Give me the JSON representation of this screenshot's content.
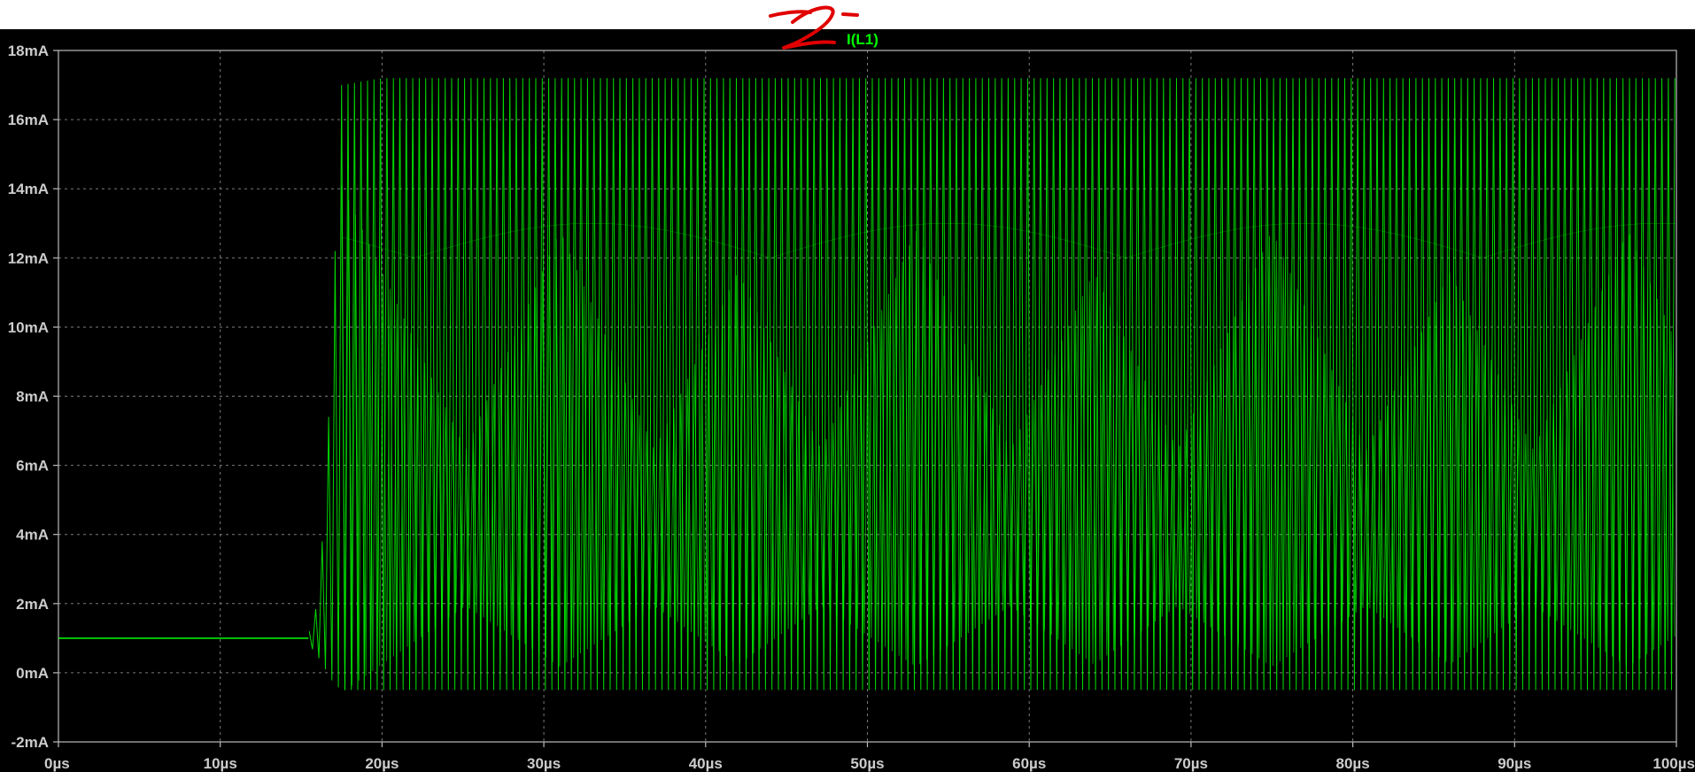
{
  "chart_data": {
    "type": "line",
    "title": "",
    "xlabel": "",
    "ylabel": "",
    "xlim": [
      0,
      100
    ],
    "ylim": [
      -2,
      18
    ],
    "x_unit": "µs",
    "y_unit": "mA",
    "x_ticks": [
      "0µs",
      "10µs",
      "20µs",
      "30µs",
      "40µs",
      "50µs",
      "60µs",
      "70µs",
      "80µs",
      "90µs",
      "100µs"
    ],
    "y_ticks": [
      "18mA",
      "16mA",
      "14mA",
      "12mA",
      "10mA",
      "8mA",
      "6mA",
      "4mA",
      "2mA",
      "0mA",
      "-2mA"
    ],
    "grid": true,
    "legend_placement": "top-center",
    "series": [
      {
        "name": "I(L1)",
        "color": "#00ff00",
        "description_points": {
          "steady_start": {
            "x": [
              0,
              15
            ],
            "y": 1.0
          },
          "onset_oscillation_x": 15.5,
          "full_oscillation_start_x": 17.5,
          "oscillation_max_y": 17.2,
          "oscillation_min_y": -0.5,
          "oscillation_period_us": 0.4,
          "envelope_beat_period_us": 22
        },
        "x": [
          0,
          5,
          10,
          14,
          15,
          15.5,
          16,
          16.5,
          17,
          17.5,
          20,
          30,
          40,
          50,
          60,
          70,
          80,
          90,
          100
        ],
        "y_upper": [
          1.0,
          1.0,
          1.0,
          1.02,
          1.05,
          1.2,
          2.0,
          5.0,
          11.0,
          17.0,
          17.2,
          17.2,
          17.2,
          17.2,
          17.2,
          17.2,
          17.2,
          17.2,
          17.2
        ],
        "y_lower": [
          1.0,
          1.0,
          1.0,
          0.98,
          0.95,
          0.8,
          0.5,
          0.1,
          -0.3,
          -0.5,
          -0.5,
          -0.5,
          -0.5,
          -0.5,
          -0.5,
          -0.5,
          -0.5,
          -0.5,
          -0.5
        ]
      }
    ],
    "annotation_mark": "handwritten red scribble near top center"
  },
  "colors": {
    "plot_bg": "#000000",
    "grid": "#7a7a7a",
    "axis": "#bbbbbb",
    "trace": "#00ff00",
    "legend": "#00ff00",
    "annotation": "#e00000"
  }
}
